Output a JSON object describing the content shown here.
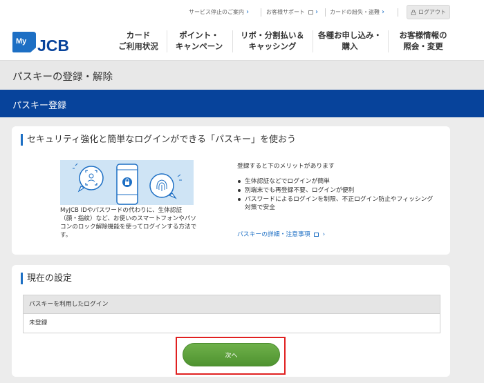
{
  "utility": {
    "service_status": "サービス停止のご案内",
    "support": "お客様サポート",
    "lost_card": "カードの紛失・盗難",
    "logout": "ログアウト"
  },
  "brand": {
    "logo_top": "My",
    "logo_main": "JCB",
    "colors": {
      "primary": "#07439b",
      "accent": "#1d6fc4",
      "button": "#5a9e3a",
      "highlight": "#e02020"
    }
  },
  "nav": [
    {
      "line1": "カード",
      "line2": "ご利用状況"
    },
    {
      "line1": "ポイント・",
      "line2": "キャンペーン"
    },
    {
      "line1": "リボ・分割払い＆",
      "line2": "キャッシング"
    },
    {
      "line1": "各種お申し込み・",
      "line2": "購入"
    },
    {
      "line1": "お客様情報の",
      "line2": "照会・変更"
    }
  ],
  "page": {
    "title": "パスキーの登録・解除",
    "section": "パスキー登録"
  },
  "passkey_card": {
    "heading": "セキュリティ強化と簡単なログインができる「パスキー」を使おう",
    "caption": "MyJCB IDやパスワードの代わりに、生体認証（顔・指紋）など、お使いのスマートフォンやパソコンのロック解除機能を使ってログインする方法です。",
    "benefit_lead": "登録すると下のメリットがあります",
    "benefits": [
      "生体認証などでログインが簡単",
      "別端末でも再登録不要、ログインが便利",
      "パスワードによるログインを制限、不正ログイン防止やフィッシング対策で安全"
    ],
    "detail_link": "パスキーの詳細・注意事項"
  },
  "current_settings": {
    "heading": "現在の設定",
    "row_header": "パスキーを利用したログイン",
    "row_value": "未登録",
    "next_button": "次へ"
  }
}
